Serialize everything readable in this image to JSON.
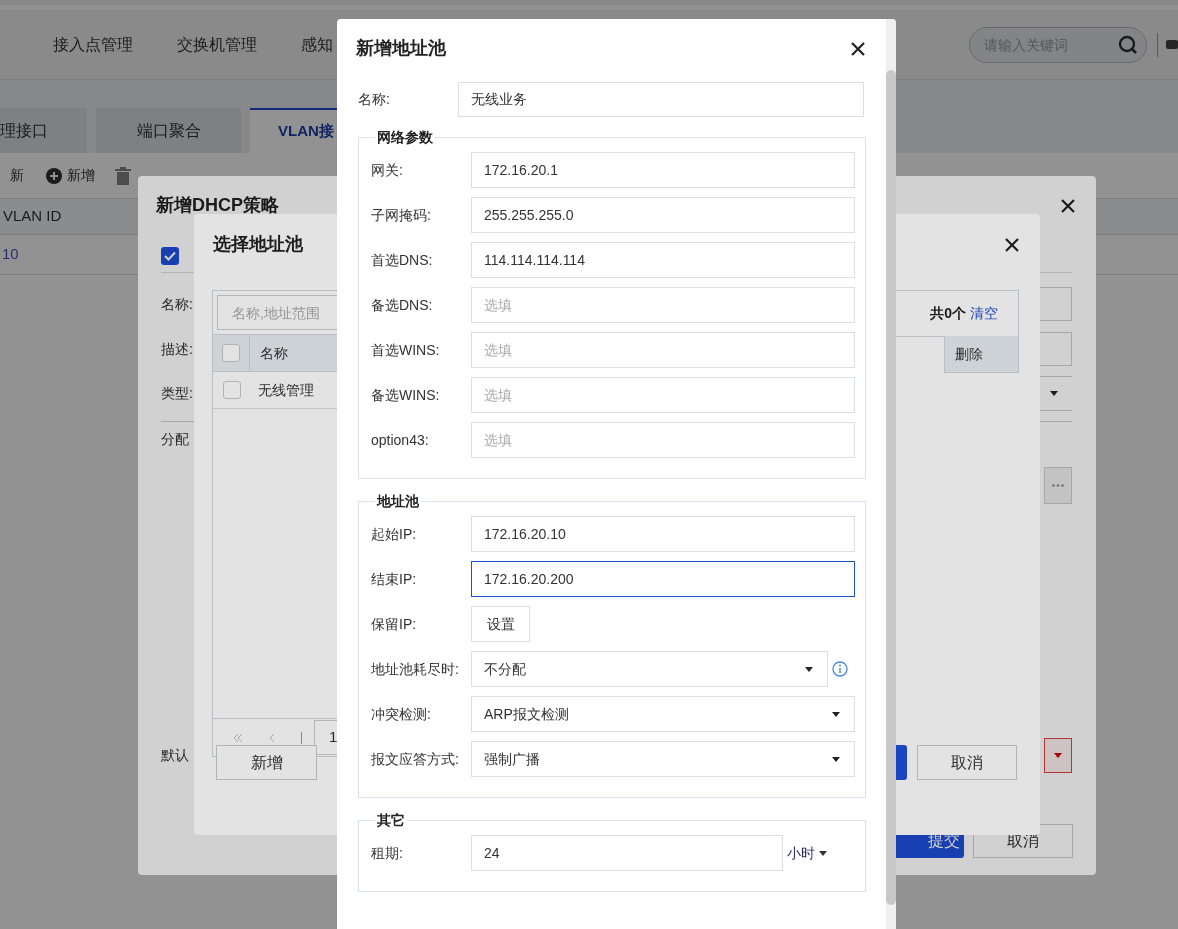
{
  "page": {
    "nav": [
      "接入点管理",
      "交换机管理",
      "感知"
    ],
    "search": {
      "placeholder": "请输入关键词"
    },
    "tabs": [
      {
        "label": "理接口",
        "selected": false
      },
      {
        "label": "端口聚合",
        "selected": false
      },
      {
        "label": "VLAN接",
        "selected": true
      }
    ],
    "toolbar": [
      {
        "kind": "refresh",
        "label": "新",
        "disabled": false
      },
      {
        "kind": "add",
        "label": "新增",
        "disabled": false
      },
      {
        "kind": "delete",
        "disabled": true
      }
    ],
    "table": {
      "columns": [
        "VLAN ID"
      ],
      "rows": [
        [
          "10"
        ]
      ]
    }
  },
  "dhcp_dialog": {
    "title": "新增DHCP策略",
    "enable": {
      "checked": true
    },
    "labels": [
      "名称:",
      "描述:",
      "类型:",
      "分配",
      "默认"
    ],
    "buttons": [
      "提交",
      "取消"
    ]
  },
  "select_dialog": {
    "title": "选择地址池",
    "search": {
      "placeholder": "名称,地址范围"
    },
    "header_checked": false,
    "columns": [
      "名称"
    ],
    "rows": [
      {
        "name": "无线管理",
        "checked": false
      }
    ],
    "summary": {
      "count": "共0个",
      "clear": "清空"
    },
    "selected_columns": [
      "删除"
    ],
    "pagination": {
      "page": "1"
    },
    "buttons": [
      "新增",
      "取消"
    ]
  },
  "pool_dialog": {
    "title": "新增地址池",
    "name": {
      "label": "名称:",
      "value": "无线业务"
    },
    "sections": [
      {
        "title": "网络参数",
        "items": [
          {
            "kind": "input",
            "label": "网关:",
            "value": "172.16.20.1",
            "focused": false
          },
          {
            "kind": "input",
            "label": "子网掩码:",
            "value": "255.255.255.0",
            "focused": false
          },
          {
            "kind": "input",
            "label": "首选DNS:",
            "value": "114.114.114.114",
            "focused": false
          },
          {
            "kind": "input",
            "label": "备选DNS:",
            "placeholder": "选填",
            "focused": false
          },
          {
            "kind": "input",
            "label": "首选WINS:",
            "placeholder": "选填",
            "focused": false
          },
          {
            "kind": "input",
            "label": "备选WINS:",
            "placeholder": "选填",
            "focused": false
          },
          {
            "kind": "input",
            "label": "option43:",
            "placeholder": "选填",
            "focused": false
          }
        ]
      },
      {
        "title": "地址池",
        "items": [
          {
            "kind": "input",
            "label": "起始IP:",
            "value": "172.16.20.10",
            "focused": false
          },
          {
            "kind": "input",
            "label": "结束IP:",
            "value": "172.16.20.200",
            "focused": true
          },
          {
            "kind": "button",
            "label": "保留IP:",
            "button": "设置"
          },
          {
            "kind": "select",
            "label": "地址池耗尽时:",
            "value": "不分配",
            "info": true
          },
          {
            "kind": "select",
            "label": "冲突检测:",
            "value": "ARP报文检测",
            "info": false
          },
          {
            "kind": "select",
            "label": "报文应答方式:",
            "value": "强制广播",
            "info": false
          }
        ]
      },
      {
        "title": "其它",
        "items": [
          {
            "kind": "lease",
            "label": "租期:",
            "value": "24",
            "unit": "小时"
          }
        ]
      }
    ]
  }
}
